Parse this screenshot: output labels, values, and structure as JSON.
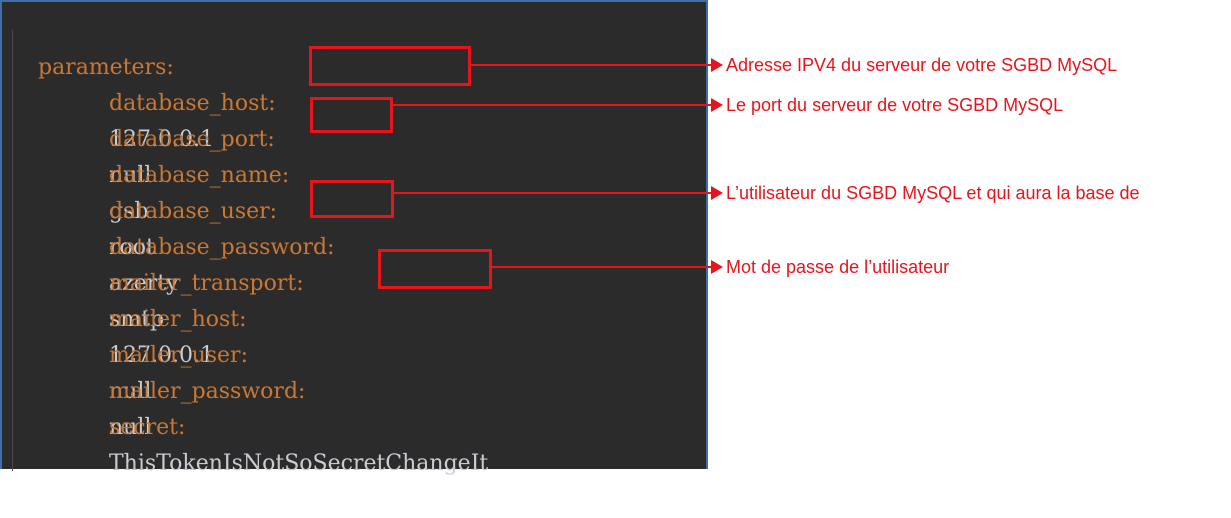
{
  "code": {
    "root_key": "parameters:",
    "lines": [
      {
        "key": "database_host:",
        "value": "127.0.0.1"
      },
      {
        "key": "database_port:",
        "value": "null"
      },
      {
        "key": "database_name:",
        "value": "gsb"
      },
      {
        "key": "database_user:",
        "value": "root"
      },
      {
        "key": "database_password:",
        "value": "azerty"
      },
      {
        "key": "mailer_transport:",
        "value": "smtp"
      },
      {
        "key": "mailer_host:",
        "value": "127.0.0.1"
      },
      {
        "key": "mailer_user:",
        "value": "null"
      },
      {
        "key": "mailer_password:",
        "value": "null"
      },
      {
        "key": "secret:",
        "value": "ThisTokenIsNotSoSecretChangeIt"
      }
    ]
  },
  "annotations": [
    {
      "target": "database_host",
      "text": "Adresse IPV4 du serveur de votre SGBD MySQL"
    },
    {
      "target": "database_port",
      "text": "Le port du serveur de votre SGBD MySQL"
    },
    {
      "target": "database_user",
      "text": "L’utilisateur du SGBD MySQL et qui aura la base de"
    },
    {
      "target": "database_password",
      "text": "Mot de passe de l’utilisateur"
    }
  ],
  "colors": {
    "editor_background": "#2b2b2b",
    "key": "#cc7832",
    "value": "#c8ccd2",
    "annotation": "#e8141c"
  }
}
